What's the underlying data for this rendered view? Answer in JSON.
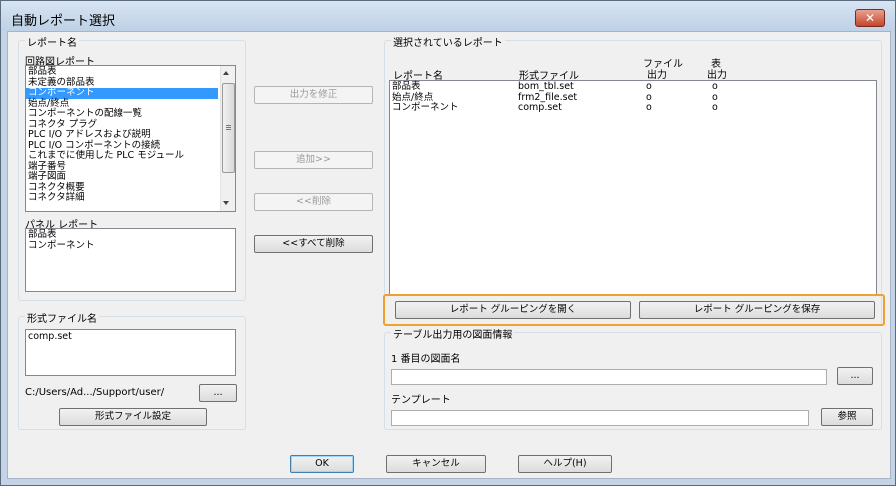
{
  "window": {
    "title": "自動レポート選択",
    "close_label": "✕"
  },
  "report_name": {
    "group_title": "レポート名",
    "schematic_label": "回路図レポート",
    "schematic_items": [
      {
        "label": "部品表",
        "selected": false
      },
      {
        "label": "未定義の部品表",
        "selected": false
      },
      {
        "label": "コンポーネント",
        "selected": true
      },
      {
        "label": "始点/終点",
        "selected": false
      },
      {
        "label": "コンポーネントの配線一覧",
        "selected": false
      },
      {
        "label": "コネクタ プラグ",
        "selected": false
      },
      {
        "label": "PLC I/O アドレスおよび説明",
        "selected": false
      },
      {
        "label": "PLC I/O コンポーネントの接続",
        "selected": false
      },
      {
        "label": "これまでに使用した PLC モジュール",
        "selected": false
      },
      {
        "label": "端子番号",
        "selected": false
      },
      {
        "label": "端子図面",
        "selected": false
      },
      {
        "label": "コネクタ概要",
        "selected": false
      },
      {
        "label": "コネクタ詳細",
        "selected": false
      }
    ],
    "panel_label": "パネル レポート",
    "panel_items": [
      "部品表",
      "コンポーネント"
    ]
  },
  "format_file": {
    "group_title": "形式ファイル名",
    "value": "comp.set",
    "path": "C:/Users/Ad.../Support/user/",
    "browse_label": "...",
    "settings_button": "形式ファイル設定"
  },
  "middle_buttons": {
    "modify_output": "出力を修正",
    "add": "追加>>",
    "remove": "<<削除",
    "remove_all": "<<すべて削除"
  },
  "selected_reports": {
    "group_title": "選択されているレポート",
    "columns": {
      "name": "レポート名",
      "format": "形式ファイル",
      "file_output_1": "ファイル",
      "file_output_2": "出力",
      "table_output_1": "表",
      "table_output_2": "出力"
    },
    "rows": [
      {
        "name": "部品表",
        "format": "bom_tbl.set",
        "file": "o",
        "table": "o"
      },
      {
        "name": "始点/終点",
        "format": "frm2_file.set",
        "file": "o",
        "table": "o"
      },
      {
        "name": "コンポーネント",
        "format": "comp.set",
        "file": "o",
        "table": "o"
      }
    ],
    "open_grouping": "レポート グルーピングを開く",
    "save_grouping": "レポート グルーピングを保存"
  },
  "table_output": {
    "group_title": "テーブル出力用の図面情報",
    "drawing_label": "1 番目の図面名",
    "drawing_value": "",
    "drawing_browse": "...",
    "template_label": "テンプレート",
    "template_value": "",
    "template_browse": "参照"
  },
  "dialog_buttons": {
    "ok": "OK",
    "cancel": "キャンセル",
    "help": "ヘルプ(H)"
  },
  "colors": {
    "selection": "#3399ff",
    "highlight_frame": "#f0a030",
    "title_bar": "#c4d4e6"
  }
}
